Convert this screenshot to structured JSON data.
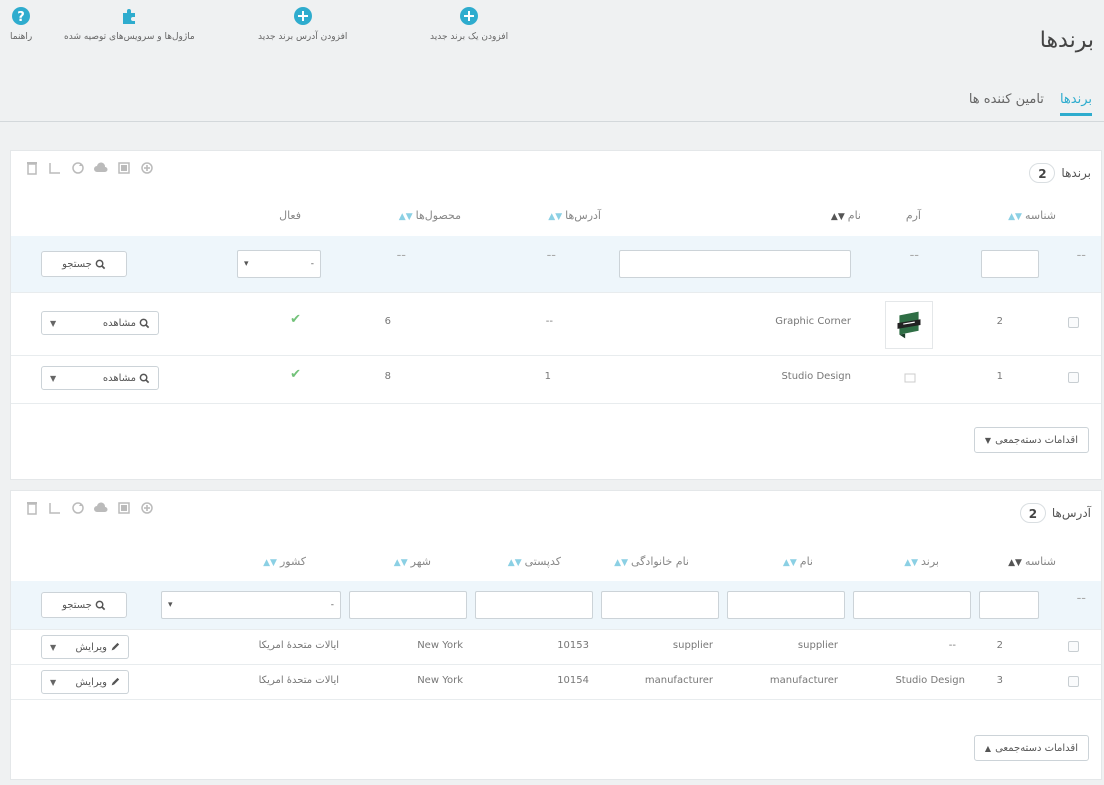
{
  "page": {
    "title": "برندها"
  },
  "toolbar": [
    {
      "label": "افزودن یک برند جدید",
      "icon": "plus-circle-icon"
    },
    {
      "label": "افزودن آدرس برند جدید",
      "icon": "plus-circle-icon"
    },
    {
      "label": "ماژول‌ها و سرویس‌های توصیه شده",
      "icon": "puzzle-icon"
    },
    {
      "label": "راهنما",
      "icon": "help-icon"
    }
  ],
  "tabs": [
    {
      "label": "برندها",
      "active": true
    },
    {
      "label": "تامین کننده ها",
      "active": false
    }
  ],
  "brands": {
    "title": "برندها",
    "count": "2",
    "columns": {
      "id": "شناسه",
      "logo": "آرم",
      "name": "نام",
      "addresses": "آدرس‌ها",
      "products": "محصول‌ها",
      "active": "فعال"
    },
    "filter": {
      "dash": "--",
      "search": "جستجو",
      "select": "-"
    },
    "rows": [
      {
        "id": "2",
        "name": "Graphic Corner",
        "addresses": "--",
        "products": "6",
        "action": "مشاهده"
      },
      {
        "id": "1",
        "name": "Studio Design",
        "addresses": "1",
        "products": "8",
        "action": "مشاهده"
      }
    ],
    "bulk": "اقدامات دسته‌جمعی"
  },
  "addresses": {
    "title": "آدرس‌ها",
    "count": "2",
    "columns": {
      "id": "شناسه",
      "brand": "برند",
      "firstname": "نام",
      "lastname": "نام خانوادگی",
      "postcode": "کدپستی",
      "city": "شهر",
      "country": "کشور"
    },
    "filter": {
      "dash": "--",
      "search": "جستجو",
      "select": "-"
    },
    "rows": [
      {
        "id": "2",
        "brand": "--",
        "firstname": "supplier",
        "lastname": "supplier",
        "postcode": "10153",
        "city": "New York",
        "country": "ایالات متحدهٔ امریکا",
        "action": "ویرایش"
      },
      {
        "id": "3",
        "brand": "Studio Design",
        "firstname": "manufacturer",
        "lastname": "manufacturer",
        "postcode": "10154",
        "city": "New York",
        "country": "ایالات متحدهٔ امریکا",
        "action": "ویرایش"
      }
    ],
    "bulk": "اقدامات دسته‌جمعی"
  },
  "colors": {
    "accent": "#2eacce",
    "check": "#72c279"
  }
}
